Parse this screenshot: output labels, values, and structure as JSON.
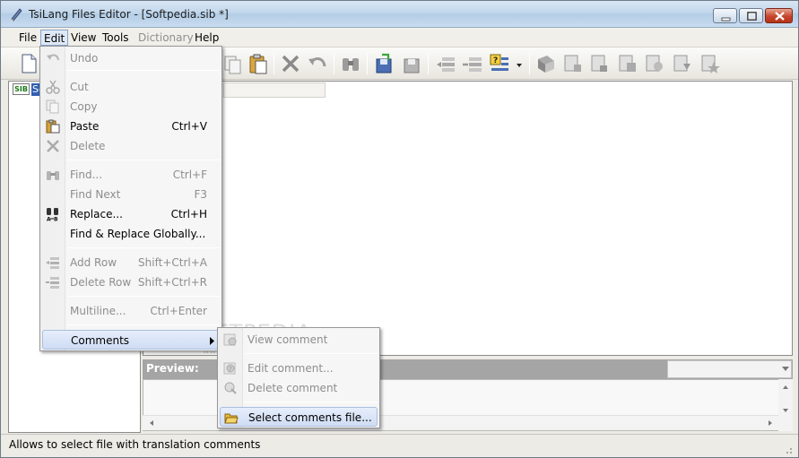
{
  "window": {
    "title": "TsiLang Files Editor - [Softpedia.sib *]"
  },
  "menubar": {
    "items": [
      {
        "label": "File",
        "disabled": false
      },
      {
        "label": "Edit",
        "disabled": false,
        "active": true
      },
      {
        "label": "View",
        "disabled": false
      },
      {
        "label": "Tools",
        "disabled": false
      },
      {
        "label": "Dictionary",
        "disabled": true
      },
      {
        "label": "Help",
        "disabled": false
      }
    ]
  },
  "tree": {
    "root_badge": "SIB",
    "root_label": "Soft"
  },
  "edit_menu": {
    "items": [
      {
        "label": "Undo",
        "shortcut": "",
        "disabled": true,
        "icon": "undo-icon"
      },
      {
        "label": "Cut",
        "shortcut": "",
        "disabled": true,
        "icon": "cut-icon"
      },
      {
        "label": "Copy",
        "shortcut": "",
        "disabled": true,
        "icon": "copy-icon"
      },
      {
        "label": "Paste",
        "shortcut": "Ctrl+V",
        "disabled": false,
        "icon": "paste-icon"
      },
      {
        "label": "Delete",
        "shortcut": "",
        "disabled": true,
        "icon": "delete-icon"
      },
      {
        "label": "Find...",
        "shortcut": "Ctrl+F",
        "disabled": true,
        "icon": "find-icon"
      },
      {
        "label": "Find Next",
        "shortcut": "F3",
        "disabled": true,
        "icon": ""
      },
      {
        "label": "Replace...",
        "shortcut": "Ctrl+H",
        "disabled": false,
        "icon": "replace-icon"
      },
      {
        "label": "Find & Replace Globally...",
        "shortcut": "",
        "disabled": false,
        "icon": ""
      },
      {
        "label": "Add Row",
        "shortcut": "Shift+Ctrl+A",
        "disabled": true,
        "icon": "add-row-icon"
      },
      {
        "label": "Delete Row",
        "shortcut": "Shift+Ctrl+R",
        "disabled": true,
        "icon": "delete-row-icon"
      },
      {
        "label": "Multiline...",
        "shortcut": "Ctrl+Enter",
        "disabled": true,
        "icon": ""
      },
      {
        "label": "Comments",
        "shortcut": "",
        "disabled": false,
        "icon": "",
        "submenu": true,
        "selected": true
      }
    ]
  },
  "comments_menu": {
    "items": [
      {
        "label": "View comment",
        "disabled": true,
        "icon": "view-comment-icon"
      },
      {
        "label": "Edit comment...",
        "disabled": true,
        "icon": "edit-comment-icon"
      },
      {
        "label": "Delete comment",
        "disabled": true,
        "icon": "delete-comment-icon"
      },
      {
        "label": "Select comments file...",
        "disabled": false,
        "selected": true,
        "icon": "folder-icon"
      }
    ]
  },
  "preview": {
    "label": "Preview:"
  },
  "statusbar": {
    "text": "Allows to select file with translation comments"
  },
  "watermark": {
    "text": "SOFTPEDIA",
    "sub": "www.softpedia.com"
  },
  "colors": {
    "menu_selected": "#cfdcf3",
    "tree_selected": "#2f5fb3",
    "preview_bar": "#a5a5a5"
  }
}
